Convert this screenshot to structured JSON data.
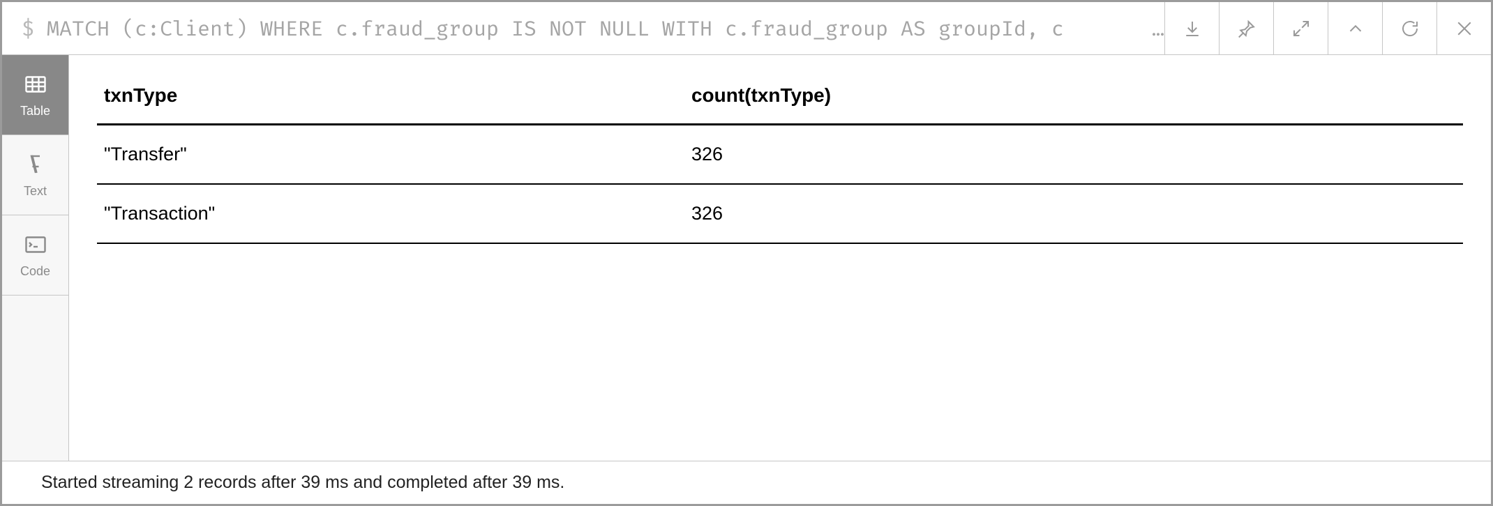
{
  "query": {
    "prompt": "$",
    "text": "MATCH (c:Client) WHERE c.fraud_group IS NOT NULL WITH c.fraud_group AS groupId, c"
  },
  "toolbar": {
    "download": "download-icon",
    "pin": "pin-icon",
    "expand": "expand-icon",
    "collapse": "collapse-icon",
    "rerun": "rerun-icon",
    "close": "close-icon"
  },
  "viewTabs": {
    "table": "Table",
    "text": "Text",
    "code": "Code"
  },
  "result": {
    "columns": [
      "txnType",
      "count(txnType)"
    ],
    "rows": [
      [
        "\"Transfer\"",
        "326"
      ],
      [
        "\"Transaction\"",
        "326"
      ]
    ]
  },
  "status": "Started streaming 2 records after 39 ms and completed after 39 ms."
}
